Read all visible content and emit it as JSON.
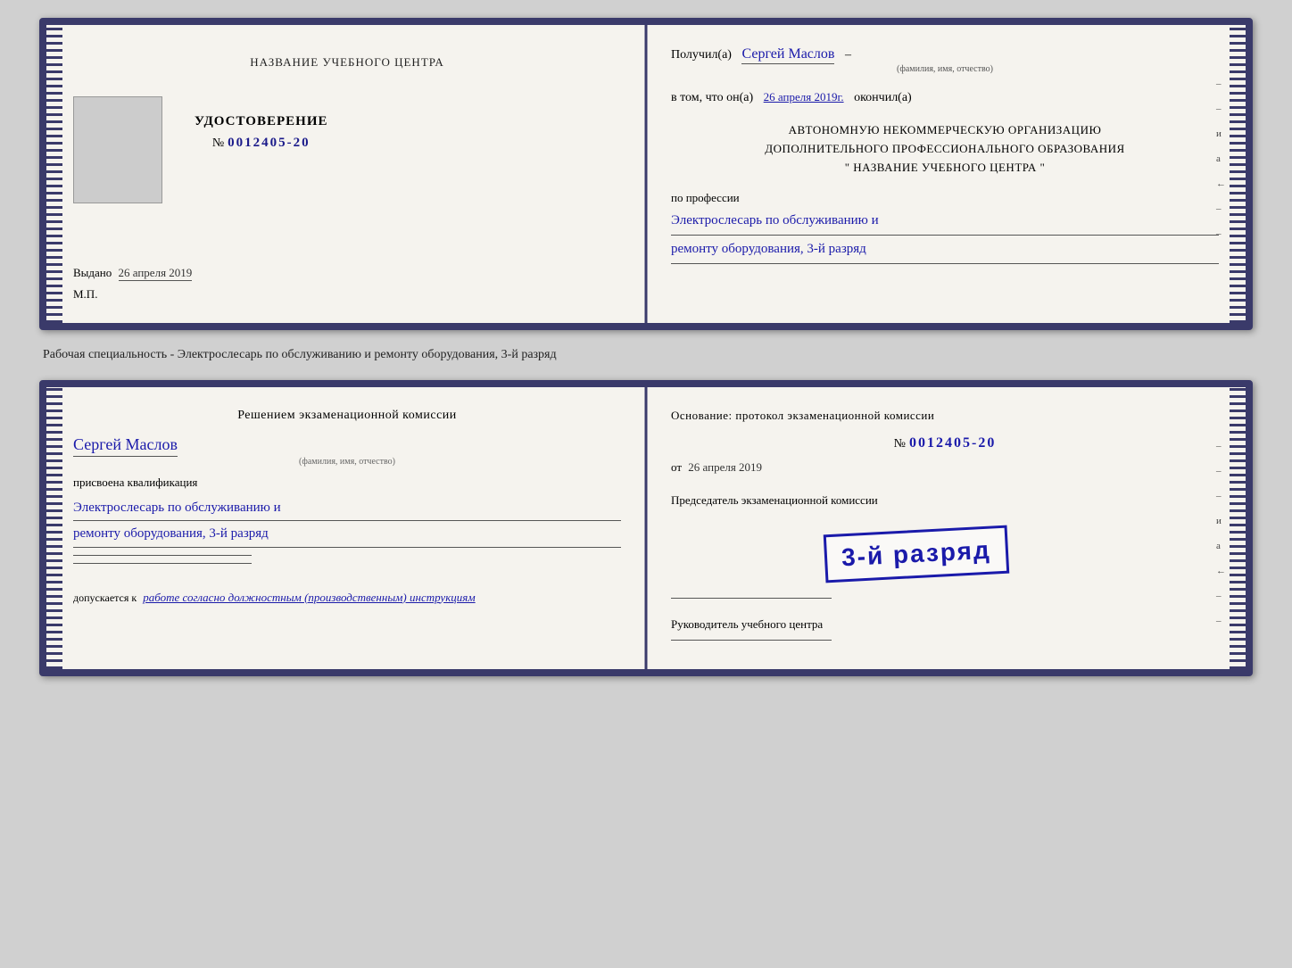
{
  "top_card": {
    "left": {
      "center_label": "НАЗВАНИЕ УЧЕБНОГО ЦЕНТРА",
      "cert_title": "УДОСТОВЕРЕНИЕ",
      "cert_number_prefix": "№",
      "cert_number": "0012405-20",
      "issued_label": "Выдано",
      "issued_date": "26 апреля 2019",
      "mp_label": "М.П."
    },
    "right": {
      "received_prefix": "Получил(а)",
      "received_name": "Сергей Маслов",
      "fio_label": "(фамилия, имя, отчество)",
      "dash": "–",
      "date_prefix": "в том, что он(а)",
      "date_value": "26 апреля 2019г.",
      "date_suffix": "окончил(а)",
      "org_line1": "АВТОНОМНУЮ НЕКОММЕРЧЕСКУЮ ОРГАНИЗАЦИЮ",
      "org_line2": "ДОПОЛНИТЕЛЬНОГО ПРОФЕССИОНАЛЬНОГО ОБРАЗОВАНИЯ",
      "org_line3": "\"  НАЗВАНИЕ УЧЕБНОГО ЦЕНТРА   \"",
      "profession_label": "по профессии",
      "profession_line1": "Электрослесарь по обслуживанию и",
      "profession_line2": "ремонту оборудования, 3-й разряд"
    }
  },
  "caption": {
    "text": "Рабочая специальность - Электрослесарь по обслуживанию и ремонту оборудования, 3-й разряд"
  },
  "bottom_card": {
    "left": {
      "decision_title": "Решением экзаменационной комиссии",
      "person_name": "Сергей Маслов",
      "fio_label": "(фамилия, имя, отчество)",
      "qualification_label": "присвоена квалификация",
      "qualification_line1": "Электрослесарь по обслуживанию и",
      "qualification_line2": "ремонту оборудования, 3-й разряд",
      "allow_prefix": "допускается к",
      "allow_text": "работе согласно должностным (производственным) инструкциям"
    },
    "right": {
      "basis_label": "Основание: протокол экзаменационной комиссии",
      "number_prefix": "№",
      "number_value": "0012405-20",
      "date_prefix": "от",
      "date_value": "26 апреля 2019",
      "chairman_label": "Председатель экзаменационной комиссии",
      "stamp_text": "3-й разряд",
      "manager_label": "Руководитель учебного центра"
    }
  },
  "side_letters": {
    "right_top": [
      "и",
      "а",
      "←",
      "–"
    ],
    "right_bottom": [
      "и",
      "а",
      "←",
      "–"
    ]
  }
}
